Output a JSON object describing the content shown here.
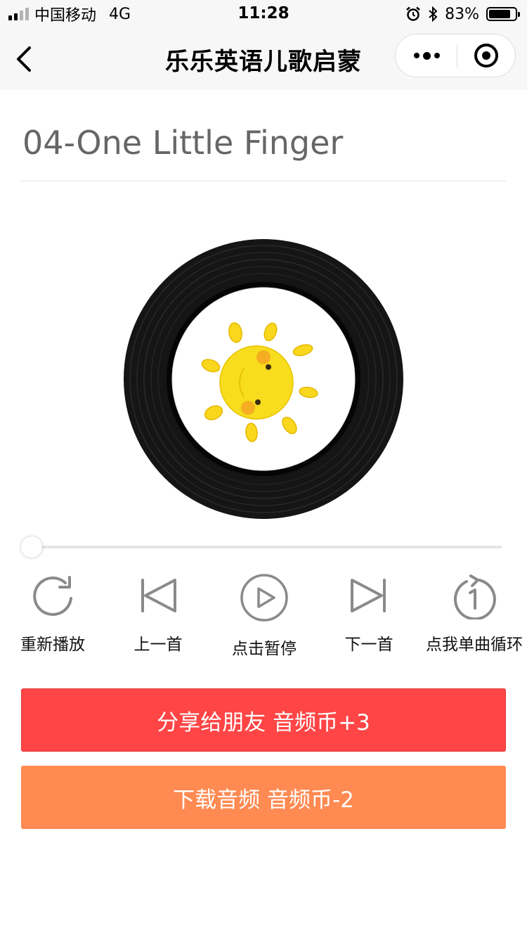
{
  "status_bar": {
    "carrier": "中国移动",
    "network": "4G",
    "time": "11:28",
    "battery_percent": "83%",
    "battery_level": 0.83,
    "icons": [
      "signal-icon",
      "alarm-icon",
      "bluetooth-icon",
      "battery-icon"
    ]
  },
  "nav": {
    "title": "乐乐英语儿歌启蒙",
    "icons": [
      "back-icon",
      "more-icon",
      "close-miniprogram-icon"
    ]
  },
  "song": {
    "title": "04-One Little Finger"
  },
  "player": {
    "progress": 0.0,
    "controls": [
      {
        "label": "重新播放",
        "icon": "replay-icon"
      },
      {
        "label": "上一首",
        "icon": "previous-icon"
      },
      {
        "label": "点击暂停",
        "icon": "play-icon"
      },
      {
        "label": "下一首",
        "icon": "next-icon"
      },
      {
        "label": "点我单曲循环",
        "icon": "repeat-one-icon"
      }
    ]
  },
  "actions": {
    "share_label": "分享给朋友 音频币+3",
    "download_label": "下载音频 音频币-2"
  },
  "colors": {
    "share_button": "#ff4545",
    "download_button": "#ff8a52",
    "icon_gray": "#8a8a8a",
    "title_gray": "#666666"
  }
}
